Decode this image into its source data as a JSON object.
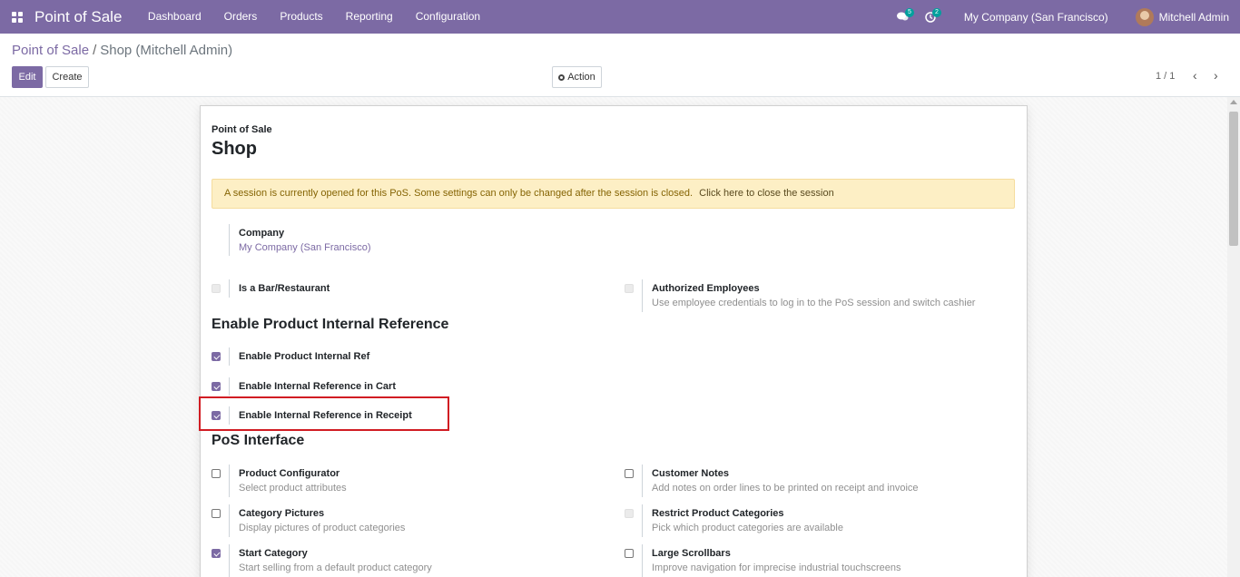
{
  "navbar": {
    "brand": "Point of Sale",
    "menu": [
      "Dashboard",
      "Orders",
      "Products",
      "Reporting",
      "Configuration"
    ],
    "messages_count": "5",
    "activities_count": "2",
    "company": "My Company (San Francisco)",
    "user": "Mitchell Admin"
  },
  "control": {
    "breadcrumb_parent": "Point of Sale",
    "breadcrumb_separator": "/",
    "breadcrumb_current": "Shop (Mitchell Admin)",
    "edit_label": "Edit",
    "create_label": "Create",
    "action_label": "Action",
    "pager": "1 / 1",
    "prev": "‹",
    "next": "›"
  },
  "form": {
    "label": "Point of Sale",
    "title": "Shop",
    "alert_text": "A session is currently opened for this PoS. Some settings can only be changed after the session is closed.",
    "alert_link": "Click here to close the session",
    "company_label": "Company",
    "company_value": "My Company (San Francisco)",
    "bar_restaurant": {
      "label": "Is a Bar/Restaurant",
      "checked": false
    },
    "authorized_employees": {
      "label": "Authorized Employees",
      "desc": "Use employee credentials to log in to the PoS session and switch cashier",
      "checked": false
    },
    "section_internal_ref": "Enable Product Internal Reference",
    "internal_ref": [
      {
        "label": "Enable Product Internal Ref",
        "checked": true
      },
      {
        "label": "Enable Internal Reference in Cart",
        "checked": true
      },
      {
        "label": "Enable Internal Reference in Receipt",
        "checked": true
      }
    ],
    "section_pos_interface": "PoS Interface",
    "pos_interface_left": [
      {
        "label": "Product Configurator",
        "desc": "Select product attributes",
        "checked": false
      },
      {
        "label": "Category Pictures",
        "desc": "Display pictures of product categories",
        "checked": false
      },
      {
        "label": "Start Category",
        "desc": "Start selling from a default product category",
        "checked": true
      }
    ],
    "pos_interface_right": [
      {
        "label": "Customer Notes",
        "desc": "Add notes on order lines to be printed on receipt and invoice",
        "checked": false
      },
      {
        "label": "Restrict Product Categories",
        "desc": "Pick which product categories are available",
        "checked": false
      },
      {
        "label": "Large Scrollbars",
        "desc": "Improve navigation for imprecise industrial touchscreens",
        "checked": false
      }
    ]
  }
}
